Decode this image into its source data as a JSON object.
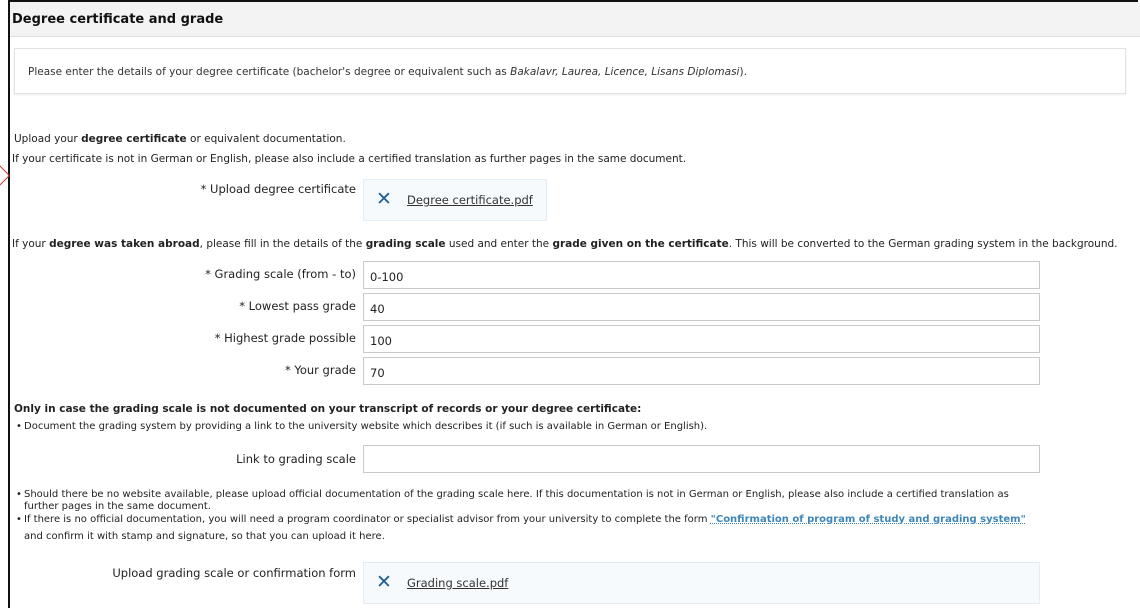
{
  "section_title": "Degree certificate and grade",
  "intro": {
    "text": "Please enter the details of your degree certificate (bachelor's degree or equivalent such as ",
    "examples": "Bakalavr, Laurea, Licence, Lisans Diplomasi",
    "end": ")."
  },
  "upload_instructions": {
    "line1_a": "Upload your ",
    "line1_bold": "degree certificate",
    "line1_b": " or equivalent documentation.",
    "line2": "If your certificate is not in German or English, please also include a certified translation as further pages in the same document."
  },
  "degree_upload": {
    "label": "* Upload degree certificate",
    "file_name": "Degree certificate.pdf",
    "remove_symbol": "✕"
  },
  "abroad_note": {
    "a": "If your ",
    "b": "degree was taken abroad",
    "c": ", please fill in the details of the ",
    "d": "grading scale",
    "e": " used and enter the ",
    "f": "grade given on the certificate",
    "g": ". This will be converted to the German grading system in the background."
  },
  "fields": {
    "grading_scale": {
      "label": "* Grading scale (from - to)",
      "value": "0-100"
    },
    "lowest_pass": {
      "label": "* Lowest pass grade",
      "value": "40"
    },
    "highest_grade": {
      "label": "* Highest grade possible",
      "value": "100"
    },
    "your_grade": {
      "label": "* Your grade",
      "value": "70"
    },
    "link_scale": {
      "label": "Link to grading scale",
      "value": ""
    }
  },
  "scale_note": {
    "heading": "Only in case the grading scale is not documented on your transcript of records or your degree certificate:",
    "bullet1": "Document the grading system by providing a link to the university website which describes it (if such is available in German or English).",
    "bullet2_line1": "Should there be no website available, please upload official documentation of the grading scale here. If this documentation is not in German or English, please also include a certified translation as",
    "bullet2_line2": "further pages in the same document.",
    "bullet3_a": "If there is no official documentation, you will need a program coordinator or specialist advisor from your university to complete the form ",
    "bullet3_link": "\"Confirmation of program of study and grading system\"",
    "bullet3_line2": "and confirm it with stamp and signature, so that you can upload it here.",
    "bullet_symbol": "•"
  },
  "scale_upload": {
    "label": "Upload grading scale or confirmation form",
    "file_name": "Grading scale.pdf",
    "remove_symbol": "✕"
  }
}
